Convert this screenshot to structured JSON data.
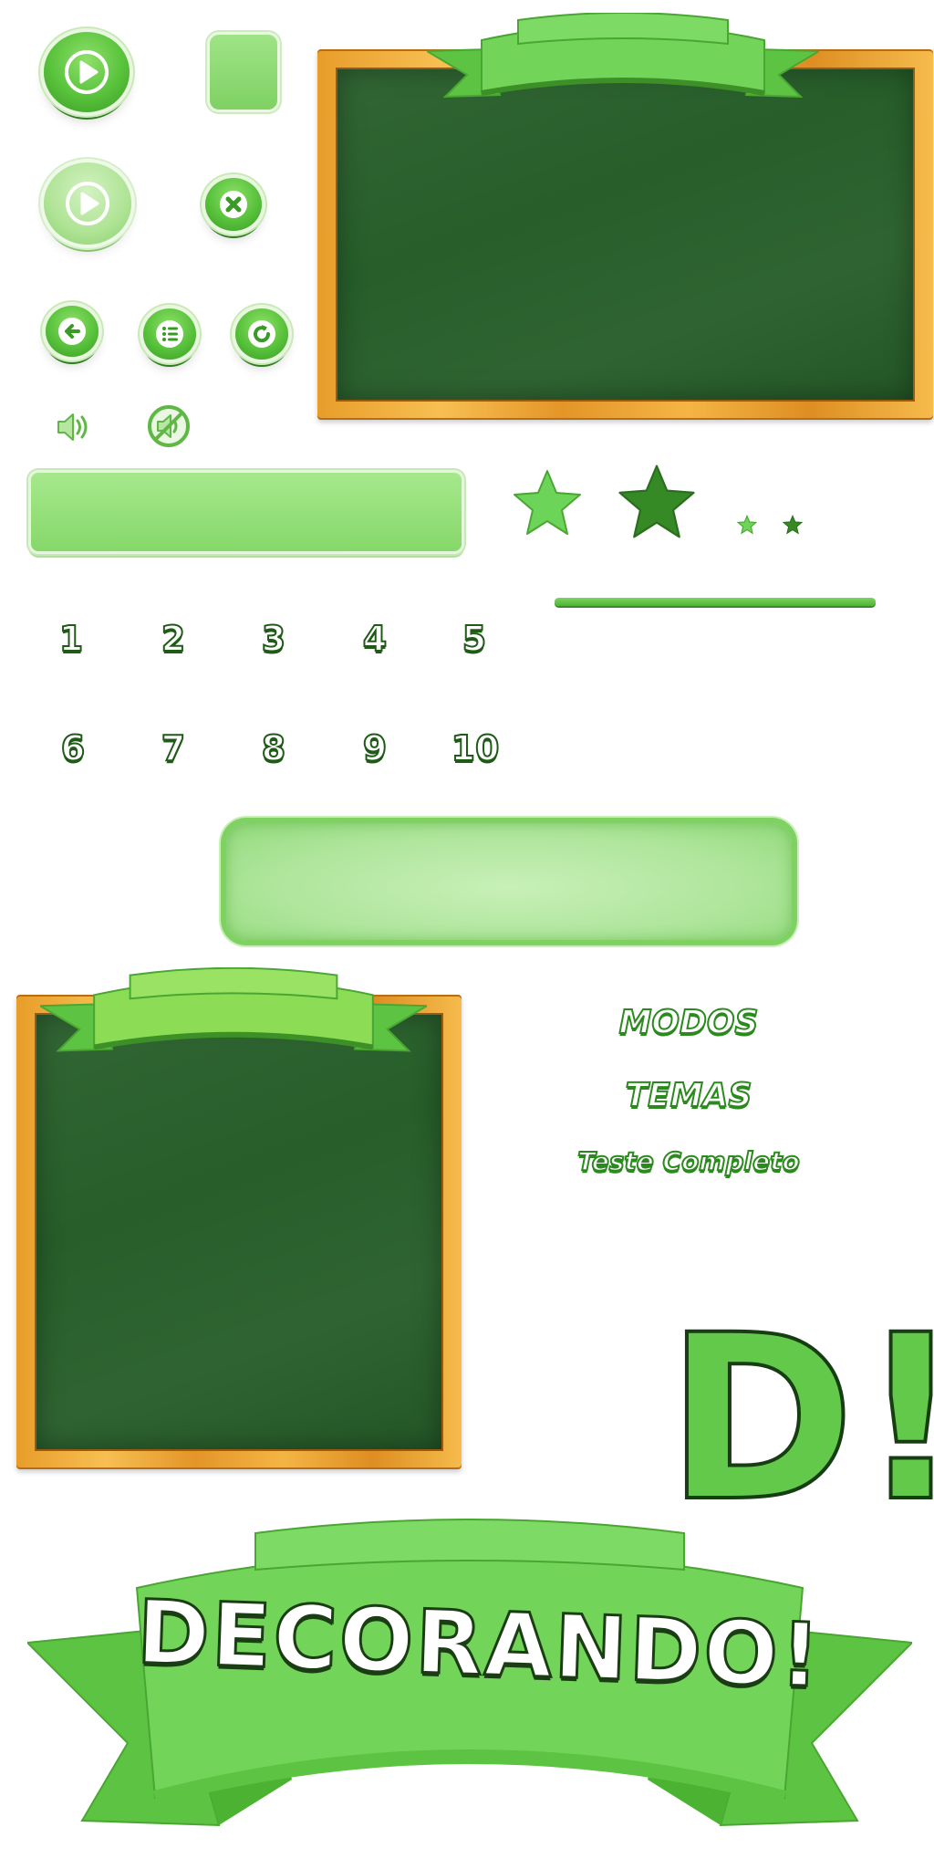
{
  "sheet": {
    "numbers_row1": [
      "1",
      "2",
      "3",
      "4",
      "5"
    ],
    "numbers_row2": [
      "6",
      "7",
      "8",
      "9",
      "10"
    ],
    "labels": {
      "modes": "MODOS",
      "themes": "TEMAS",
      "full_test": "Teste Completo"
    },
    "logo_initial": "D!",
    "banner_title": "DECORANDO!"
  },
  "colors": {
    "button_green": "#58c23b",
    "pale_green": "#aee394",
    "chalkboard": "#275e2a",
    "wood_frame": "#f0ad3c",
    "ribbon_green": "#6dd25a",
    "text_outline": "#1f5a17"
  },
  "icons": [
    "play-icon",
    "close-icon",
    "back-arrow-icon",
    "menu-list-icon",
    "refresh-icon",
    "sound-on-icon",
    "sound-off-icon",
    "star-icon"
  ]
}
